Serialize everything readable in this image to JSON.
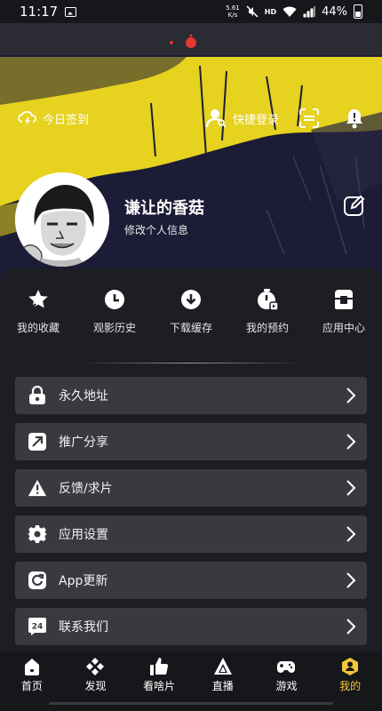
{
  "status_bar": {
    "time": "11:17",
    "net_speed_value": "5.61",
    "net_speed_unit": "K/s",
    "hd": "HD",
    "battery": "44%"
  },
  "header": {
    "checkin_label": "今日签到",
    "quick_login_label": "快捷登录"
  },
  "profile": {
    "username": "谦让的香菇",
    "edit_info": "修改个人信息"
  },
  "quick_actions": [
    {
      "label": "我的收藏",
      "icon": "star-icon"
    },
    {
      "label": "观影历史",
      "icon": "clock-icon"
    },
    {
      "label": "下载缓存",
      "icon": "download-icon"
    },
    {
      "label": "我的预约",
      "icon": "reservation-icon"
    },
    {
      "label": "应用中心",
      "icon": "app-center-icon"
    }
  ],
  "menu": [
    {
      "label": "永久地址",
      "icon": "lock-icon"
    },
    {
      "label": "推广分享",
      "icon": "share-icon"
    },
    {
      "label": "反馈/求片",
      "icon": "warning-icon"
    },
    {
      "label": "应用设置",
      "icon": "gear-icon"
    },
    {
      "label": "App更新",
      "icon": "refresh-icon"
    },
    {
      "label": "联系我们",
      "icon": "support-24-icon",
      "icon_text": "24"
    }
  ],
  "tabs": [
    {
      "label": "首页",
      "icon": "home-icon",
      "active": false
    },
    {
      "label": "发现",
      "icon": "discover-icon",
      "active": false
    },
    {
      "label": "看啥片",
      "icon": "thumbs-up-icon",
      "active": false
    },
    {
      "label": "直播",
      "icon": "live-icon",
      "active": false
    },
    {
      "label": "游戏",
      "icon": "gamepad-icon",
      "active": false
    },
    {
      "label": "我的",
      "icon": "profile-icon",
      "active": true
    }
  ],
  "colors": {
    "accent": "#f4c83a",
    "paint_yellow": "#e6d21f",
    "hero_bg": "#1c1c36",
    "panel_bg": "#1d1e23",
    "menu_item_bg": "#393a40"
  }
}
